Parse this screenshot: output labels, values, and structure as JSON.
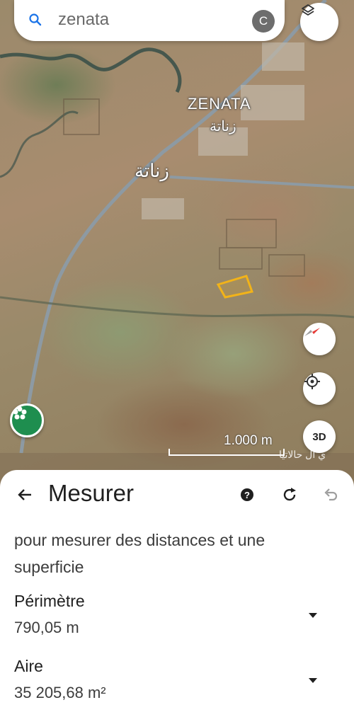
{
  "search": {
    "query": "zenata",
    "avatar_letter": "C"
  },
  "map": {
    "label_latin": "ZENATA",
    "label_arabic_small": "زناتة",
    "label_arabic_large": "زناتة",
    "scale_text": "1.000 m",
    "watermark": "ي ال حالاتيا",
    "btn_3d": "3D",
    "measured_shape_color": "#f2b319"
  },
  "sheet": {
    "title": "Mesurer",
    "instructions": "pour mesurer des distances et une superficie",
    "perimeter_label": "Périmètre",
    "perimeter_value": "790,05 m",
    "area_label": "Aire",
    "area_value": "35 205,68 m²"
  },
  "icons": {
    "search": "search-icon",
    "layers": "layers-icon",
    "compass": "compass-icon",
    "locate": "my-location-icon",
    "back": "arrow-back-icon",
    "help": "help-icon",
    "refresh": "refresh-icon",
    "undo": "undo-icon",
    "caret": "caret-down-icon",
    "poi": "poi-flower-icon"
  }
}
